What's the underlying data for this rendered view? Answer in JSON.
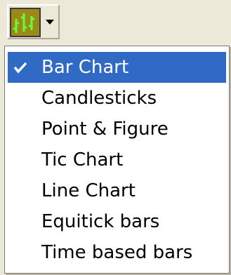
{
  "toolbar": {
    "chart_type_button": {
      "icon": "bar-chart-icon",
      "arrow_icon": "dropdown-arrow-icon",
      "colors": {
        "icon_background": "#9a8a1a",
        "bars": "#66ff33"
      }
    }
  },
  "menu": {
    "selected_index": 0,
    "check_icon": "checkmark-icon",
    "items": [
      {
        "label": "Bar Chart",
        "checked": true
      },
      {
        "label": "Candlesticks",
        "checked": false
      },
      {
        "label": "Point & Figure",
        "checked": false
      },
      {
        "label": "Tic Chart",
        "checked": false
      },
      {
        "label": "Line Chart",
        "checked": false
      },
      {
        "label": "Equitick bars",
        "checked": false
      },
      {
        "label": "Time based bars",
        "checked": false
      }
    ],
    "colors": {
      "highlight": "#316ac5",
      "highlight_text": "#ffffff",
      "text": "#000000"
    }
  }
}
